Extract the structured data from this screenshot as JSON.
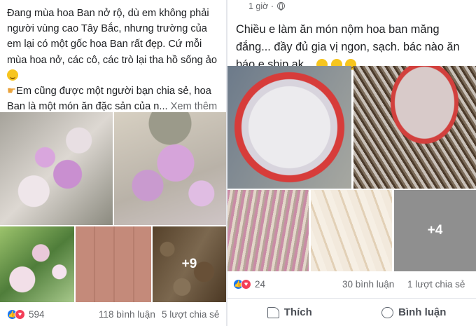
{
  "left_post": {
    "text_line1": "Đang mùa hoa Ban nở rộ, dù em không phải người vùng cao Tây Bắc, nhưng trường của em lại có một gốc hoa Ban rất đẹp. Cứ mỗi mùa hoa nở, các cô, các trò lại tha hồ sống ảo",
    "text_line2_prefix": "Em cũng được một người bạn chia sẻ, hoa Ban là một món ăn đặc sản của n...",
    "see_more": "Xem thêm",
    "photo_more": "+9",
    "reaction_count": "594",
    "comments": "118 bình luận",
    "shares": "5 lượt chia sẻ"
  },
  "right_post": {
    "time": "1 giờ ·",
    "text": "Chiều e làm ăn món nộm hoa ban măng đắng... đầy đủ gia vị ngon, sạch. bác nào ăn báo e ship ak...",
    "photo_more": "+4",
    "reaction_count": "24",
    "comments": "30 bình luận",
    "shares": "1 lượt chia sẻ",
    "like_label": "Thích",
    "comment_label": "Bình luận"
  },
  "icons": [
    "globe-icon",
    "like-icon",
    "heart-icon",
    "emoji-icon",
    "thumb-icon",
    "comment-icon"
  ],
  "colors": {
    "like_blue": "#1877f2",
    "love_red": "#f33e58",
    "secondary_text": "#65676b"
  }
}
